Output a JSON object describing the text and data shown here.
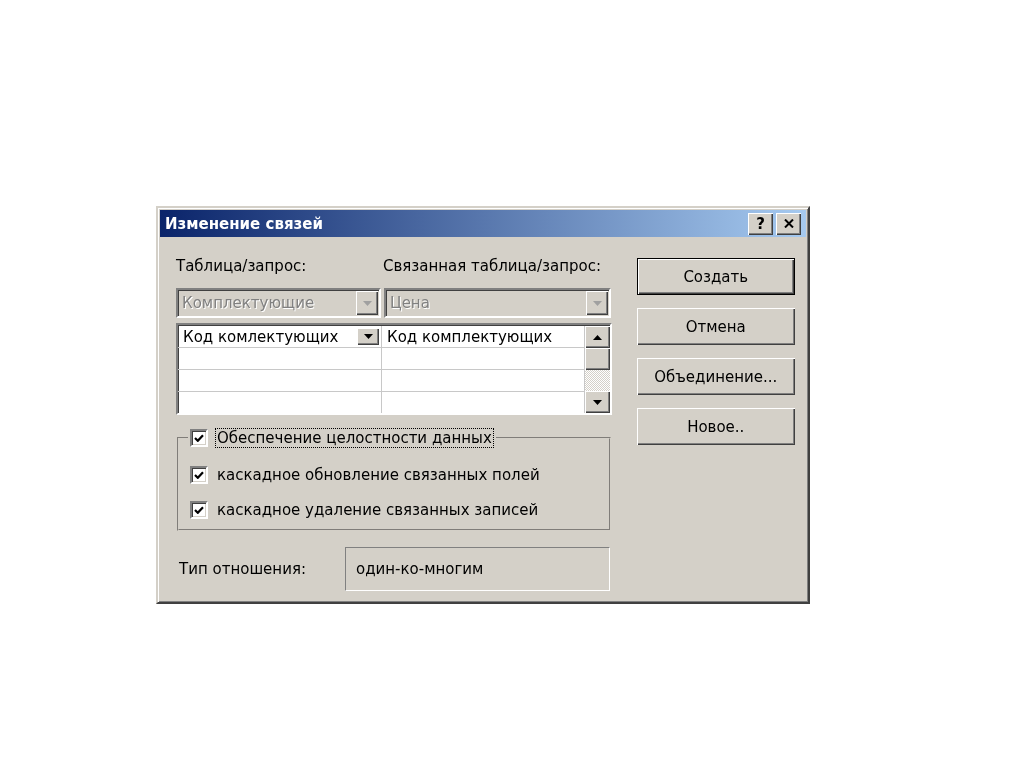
{
  "window": {
    "title": "Изменение связей",
    "help_label": "?"
  },
  "selectors": [
    {
      "label": "Таблица/запрос:",
      "value": "Комплектующие",
      "disabled": true
    },
    {
      "label": "Связанная таблица/запрос:",
      "value": "Цена",
      "disabled": true
    }
  ],
  "field_grid": {
    "rows": [
      {
        "cells": [
          "Код комлектующих",
          "Код комплектующих"
        ],
        "selected": true
      }
    ]
  },
  "integrity": {
    "label": "Обеспечение целостности данных",
    "checked": true,
    "focused": true
  },
  "cascade_options": [
    {
      "label": "каскадное обновление связанных полей",
      "checked": true
    },
    {
      "label": "каскадное удаление связанных записей",
      "checked": true
    }
  ],
  "relationship": {
    "label": "Тип отношения:",
    "value": "один-ко-многим"
  },
  "buttons": [
    {
      "label": "Создать",
      "default": true
    },
    {
      "label": "Отмена",
      "default": false
    },
    {
      "label": "Объединение...",
      "default": false
    },
    {
      "label": "Новое..",
      "default": false
    }
  ]
}
